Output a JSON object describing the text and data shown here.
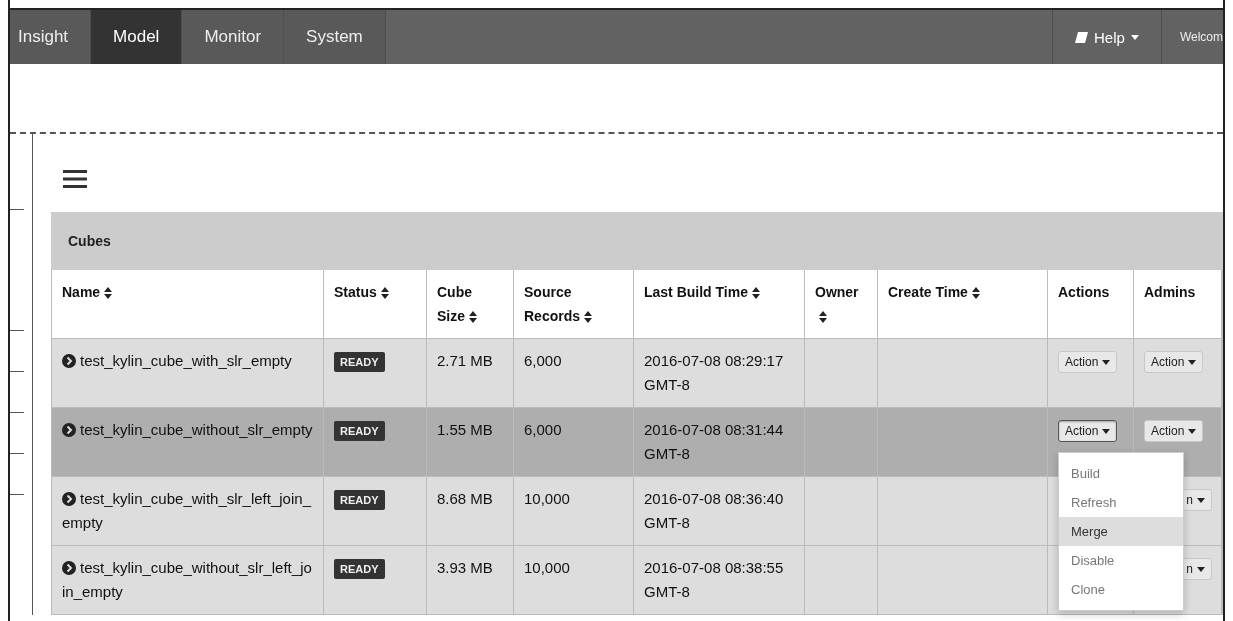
{
  "navbar": {
    "tabs": [
      {
        "label": "Insight",
        "selected": false
      },
      {
        "label": "Model",
        "selected": true
      },
      {
        "label": "Monitor",
        "selected": false
      },
      {
        "label": "System",
        "selected": false
      }
    ],
    "help": "Help",
    "welcome": "Welcom"
  },
  "panel": {
    "title": "Cubes"
  },
  "table": {
    "columns": [
      {
        "label": "Name",
        "sortable": true
      },
      {
        "label": "Status",
        "sortable": true
      },
      {
        "label": "Cube Size",
        "sortable": true
      },
      {
        "label": "Source Records",
        "sortable": true
      },
      {
        "label": "Last Build Time",
        "sortable": true
      },
      {
        "label": "Owner",
        "sortable": true
      },
      {
        "label": "Create Time",
        "sortable": true
      },
      {
        "label": "Actions",
        "sortable": false
      },
      {
        "label": "Admins",
        "sortable": false
      }
    ],
    "rows": [
      {
        "name": "test_kylin_cube_with_slr_empty",
        "status": "READY",
        "cube_size": "2.71 MB",
        "source_records": "6,000",
        "last_build_time": "2016-07-08 08:29:17 GMT-8",
        "selected": false,
        "action": {
          "label": "Action",
          "expanded": false
        },
        "admin": {
          "label": "Action"
        }
      },
      {
        "name": "test_kylin_cube_without_slr_empty",
        "status": "READY",
        "cube_size": "1.55 MB",
        "source_records": "6,000",
        "last_build_time": "2016-07-08 08:31:44 GMT-8",
        "selected": true,
        "action": {
          "label": "Action",
          "expanded": true
        },
        "admin": {
          "label": "Action"
        }
      },
      {
        "name": "test_kylin_cube_with_slr_left_join_empty",
        "status": "READY",
        "cube_size": "8.68 MB",
        "source_records": "10,000",
        "last_build_time": "2016-07-08 08:36:40 GMT-8",
        "selected": false,
        "admin": {
          "label": "n"
        }
      },
      {
        "name": "test_kylin_cube_without_slr_left_join_empty",
        "status": "READY",
        "cube_size": "3.93 MB",
        "source_records": "10,000",
        "last_build_time": "2016-07-08 08:38:55 GMT-8",
        "selected": false,
        "admin": {
          "label": "n"
        }
      }
    ]
  },
  "action_menu": {
    "items": [
      {
        "label": "Build",
        "selected": false
      },
      {
        "label": "Refresh",
        "selected": false
      },
      {
        "label": "Merge",
        "selected": true
      },
      {
        "label": "Disable",
        "selected": false
      },
      {
        "label": "Clone",
        "selected": false
      }
    ]
  }
}
